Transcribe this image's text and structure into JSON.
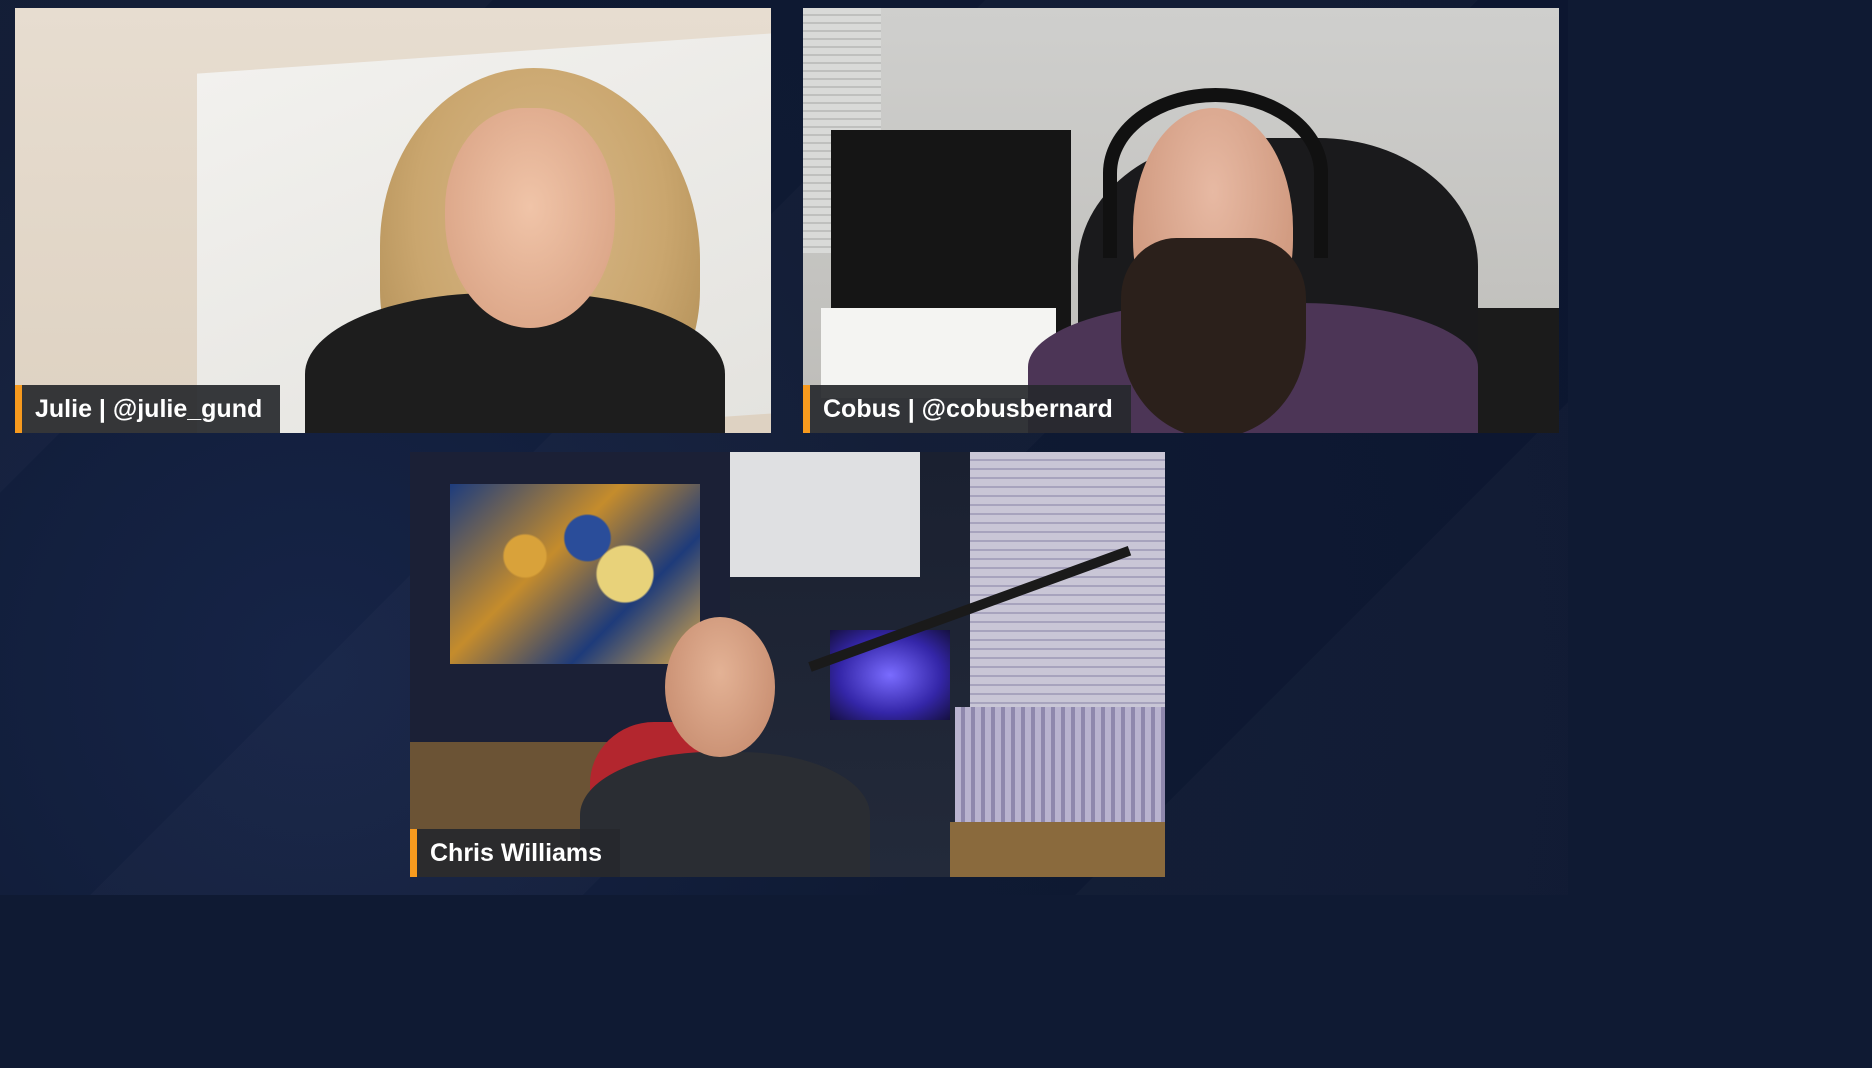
{
  "participants": [
    {
      "label": "Julie | @julie_gund"
    },
    {
      "label": "Cobus | @cobusbernard"
    },
    {
      "label": "Chris Williams"
    }
  ],
  "colors": {
    "background": "#0f1a33",
    "name_accent": "#f79a1e",
    "name_bar": "#26282c",
    "name_text": "#ffffff"
  }
}
